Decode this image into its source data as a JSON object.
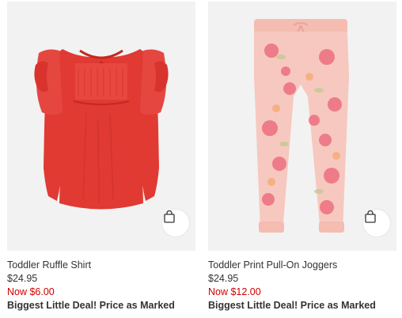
{
  "products": [
    {
      "name": "Toddler Ruffle Shirt",
      "list_price": "$24.95",
      "sale_price": "Now $6.00",
      "promo": "Biggest Little Deal! Price as Marked",
      "icon": "shopping-bag-icon",
      "colors": {
        "primary": "#e03a33",
        "shadow": "#c4291f"
      }
    },
    {
      "name": "Toddler Print Pull-On Joggers",
      "list_price": "$24.95",
      "sale_price": "Now $12.00",
      "promo": "Biggest Little Deal! Price as Marked",
      "icon": "shopping-bag-icon",
      "colors": {
        "primary": "#f7c8bf",
        "accent": "#ec6f7f"
      }
    }
  ],
  "colors": {
    "sale": "#d00000",
    "image_bg": "#f2f2f2"
  }
}
